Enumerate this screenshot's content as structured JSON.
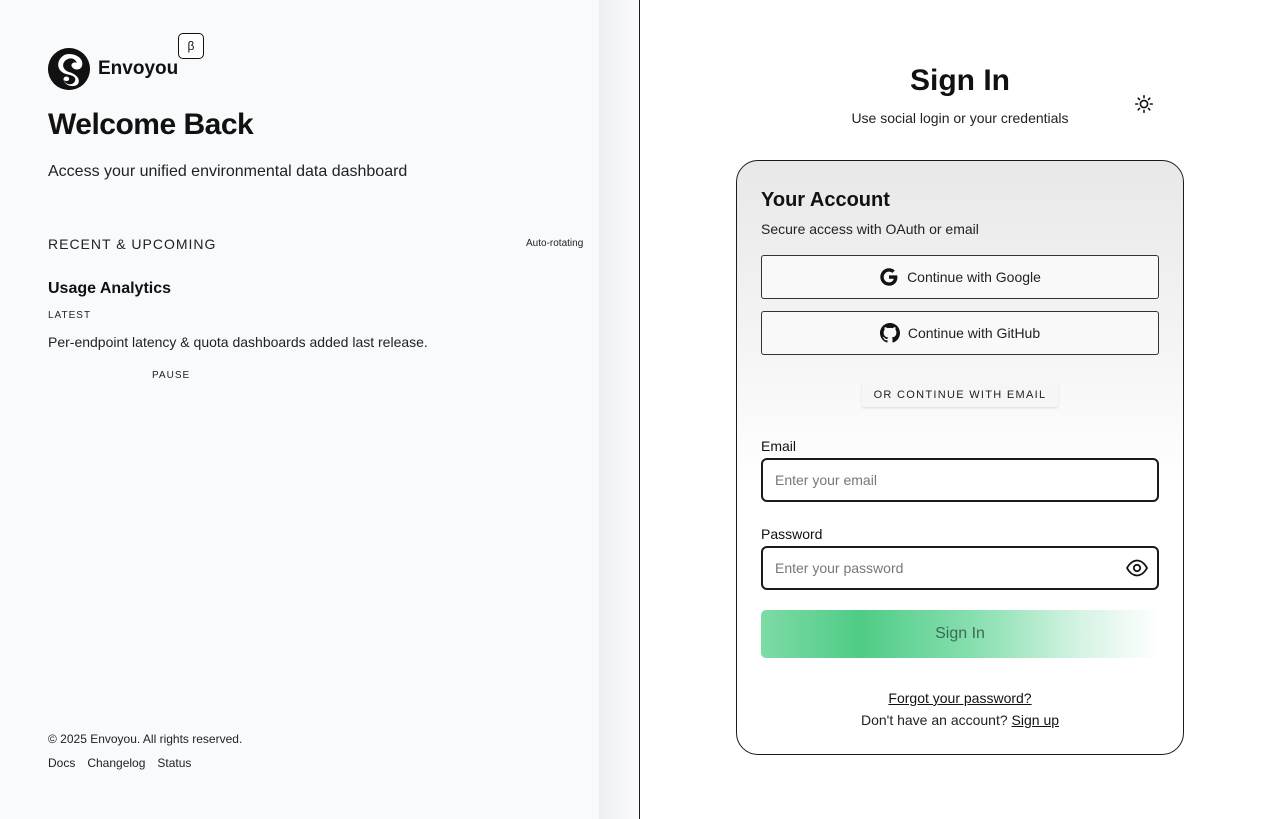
{
  "brand": {
    "name": "Envoyou",
    "beta_badge": "β",
    "logo_icon": "envoyou-logo-icon"
  },
  "left": {
    "welcome": "Welcome Back",
    "subtitle": "Access your unified environmental data dashboard",
    "recent_heading": "RECENT & UPCOMING",
    "auto_rotating": "Auto-rotating",
    "item": {
      "title": "Usage Analytics",
      "tag": "LATEST",
      "description": "Per-endpoint latency & quota dashboards added last release."
    },
    "pause_label": "PAUSE",
    "copyright": "© 2025 Envoyou. All rights reserved.",
    "footer_links": [
      "Docs",
      "Changelog",
      "Status"
    ]
  },
  "signin": {
    "title": "Sign In",
    "subtitle": "Use social login or your credentials",
    "theme_icon": "sun-icon",
    "card": {
      "title": "Your Account",
      "subtitle": "Secure access with OAuth or email",
      "google_label": "Continue with Google",
      "github_label": "Continue with GitHub",
      "separator": "OR CONTINUE WITH EMAIL",
      "email_label": "Email",
      "email_placeholder": "Enter your email",
      "email_value": "",
      "password_label": "Password",
      "password_placeholder": "Enter your password",
      "password_value": "",
      "submit_label": "Sign In",
      "forgot_label": "Forgot your password?",
      "no_account_text": "Don't have an account?",
      "signup_label": "Sign up"
    }
  },
  "colors": {
    "accent_green": "#4fcc86",
    "left_bg": "#f8fafc",
    "text": "#111111"
  }
}
